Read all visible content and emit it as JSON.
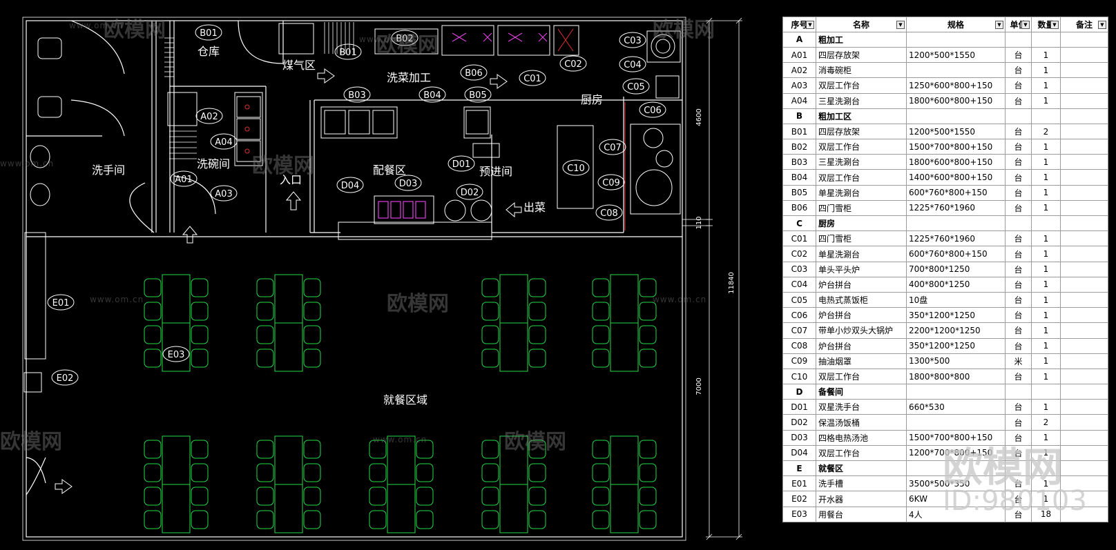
{
  "plan": {
    "labels": [
      {
        "text": "B01",
        "type": "tag"
      },
      {
        "text": "仓库",
        "type": "room"
      },
      {
        "text": "煤气区",
        "type": "room"
      },
      {
        "text": "B01",
        "type": "tag"
      },
      {
        "text": "B02",
        "type": "tag"
      },
      {
        "text": "洗菜加工",
        "type": "room"
      },
      {
        "text": "B06",
        "type": "tag"
      },
      {
        "text": "C01",
        "type": "tag"
      },
      {
        "text": "C02",
        "type": "tag"
      },
      {
        "text": "C03",
        "type": "tag"
      },
      {
        "text": "C04",
        "type": "tag"
      },
      {
        "text": "C05",
        "type": "tag"
      },
      {
        "text": "C06",
        "type": "tag"
      },
      {
        "text": "C07",
        "type": "tag"
      },
      {
        "text": "C09",
        "type": "tag"
      },
      {
        "text": "C08",
        "type": "tag"
      },
      {
        "text": "C10",
        "type": "tag"
      },
      {
        "text": "厨房",
        "type": "room"
      },
      {
        "text": "A02",
        "type": "tag"
      },
      {
        "text": "A04",
        "type": "tag"
      },
      {
        "text": "A01",
        "type": "tag"
      },
      {
        "text": "A03",
        "type": "tag"
      },
      {
        "text": "洗碗间",
        "type": "room"
      },
      {
        "text": "洗手间",
        "type": "room"
      },
      {
        "text": "入口",
        "type": "room"
      },
      {
        "text": "B03",
        "type": "tag"
      },
      {
        "text": "B04",
        "type": "tag"
      },
      {
        "text": "B05",
        "type": "tag"
      },
      {
        "text": "D01",
        "type": "tag"
      },
      {
        "text": "预进间",
        "type": "room"
      },
      {
        "text": "配餐区",
        "type": "room"
      },
      {
        "text": "D04",
        "type": "tag"
      },
      {
        "text": "D03",
        "type": "tag"
      },
      {
        "text": "D02",
        "type": "tag"
      },
      {
        "text": "出菜",
        "type": "room"
      },
      {
        "text": "E01",
        "type": "tag"
      },
      {
        "text": "E03",
        "type": "tag"
      },
      {
        "text": "E02",
        "type": "tag"
      },
      {
        "text": "就餐区域",
        "type": "room"
      }
    ],
    "dimensions": [
      "4600",
      "110",
      "11840",
      "7000"
    ]
  },
  "watermarks": {
    "brand": "欧模网",
    "site": "www.om.cn",
    "id": "ID:980103"
  },
  "table": {
    "headers": [
      "序号",
      "名称",
      "规格",
      "单位",
      "数量",
      "备注"
    ],
    "rows": [
      {
        "section": true,
        "code": "A",
        "name": "粗加工",
        "spec": "",
        "unit": "",
        "qty": ""
      },
      {
        "code": "A01",
        "name": "四层存放架",
        "spec": "1200*500*1550",
        "unit": "台",
        "qty": "1"
      },
      {
        "code": "A02",
        "name": "消毒碗柜",
        "spec": "",
        "unit": "台",
        "qty": "1"
      },
      {
        "code": "A03",
        "name": "双层工作台",
        "spec": "1250*600*800+150",
        "unit": "台",
        "qty": "1"
      },
      {
        "code": "A04",
        "name": "三星洗涮台",
        "spec": "1800*600*800+150",
        "unit": "台",
        "qty": "1"
      },
      {
        "section": true,
        "code": "B",
        "name": "粗加工区",
        "spec": "",
        "unit": "",
        "qty": ""
      },
      {
        "code": "B01",
        "name": "四层存放架",
        "spec": "1200*500*1550",
        "unit": "台",
        "qty": "2"
      },
      {
        "code": "B02",
        "name": "双层工作台",
        "spec": "1500*700*800+150",
        "unit": "台",
        "qty": "1"
      },
      {
        "code": "B03",
        "name": "三星洗涮台",
        "spec": "1800*600*800+150",
        "unit": "台",
        "qty": "1"
      },
      {
        "code": "B04",
        "name": "双层工作台",
        "spec": "1400*600*800+150",
        "unit": "台",
        "qty": "1"
      },
      {
        "code": "B05",
        "name": "单星洗涮台",
        "spec": "600*760*800+150",
        "unit": "台",
        "qty": "1"
      },
      {
        "code": "B06",
        "name": "四门雪柜",
        "spec": "1225*760*1960",
        "unit": "台",
        "qty": "1"
      },
      {
        "section": true,
        "code": "C",
        "name": "厨房",
        "spec": "",
        "unit": "",
        "qty": ""
      },
      {
        "code": "C01",
        "name": "四门雪柜",
        "spec": "1225*760*1960",
        "unit": "台",
        "qty": "1"
      },
      {
        "code": "C02",
        "name": "单星洗涮台",
        "spec": "600*760*800+150",
        "unit": "台",
        "qty": "1"
      },
      {
        "code": "C03",
        "name": "单头平头炉",
        "spec": "700*800*1250",
        "unit": "台",
        "qty": "1"
      },
      {
        "code": "C04",
        "name": "炉台拼台",
        "spec": "400*800*1250",
        "unit": "台",
        "qty": "1"
      },
      {
        "code": "C05",
        "name": "电热式蒸饭柜",
        "spec": "10盘",
        "unit": "台",
        "qty": "1"
      },
      {
        "code": "C06",
        "name": "炉台拼台",
        "spec": "350*1200*1250",
        "unit": "台",
        "qty": "1"
      },
      {
        "code": "C07",
        "name": "带单小炒双头大锅炉",
        "spec": "2200*1200*1250",
        "unit": "台",
        "qty": "1"
      },
      {
        "code": "C08",
        "name": "炉台拼台",
        "spec": "350*1200*1250",
        "unit": "台",
        "qty": "1"
      },
      {
        "code": "C09",
        "name": "抽油烟罩",
        "spec": "1300*500",
        "unit": "米",
        "qty": "1"
      },
      {
        "code": "C10",
        "name": "双层工作台",
        "spec": "1800*800*800",
        "unit": "台",
        "qty": "1"
      },
      {
        "section": true,
        "code": "D",
        "name": "备餐间",
        "spec": "",
        "unit": "",
        "qty": ""
      },
      {
        "code": "D01",
        "name": "双星洗手台",
        "spec": "660*530",
        "unit": "台",
        "qty": "1"
      },
      {
        "code": "D02",
        "name": "保温汤饭桶",
        "spec": "",
        "unit": "台",
        "qty": "2"
      },
      {
        "code": "D03",
        "name": "四格电热汤池",
        "spec": "1500*700*800+150",
        "unit": "台",
        "qty": "1"
      },
      {
        "code": "D04",
        "name": "双层工作台",
        "spec": "1200*700*800+150",
        "unit": "台",
        "qty": "1"
      },
      {
        "section": true,
        "code": "E",
        "name": "就餐区",
        "spec": "",
        "unit": "",
        "qty": ""
      },
      {
        "code": "E01",
        "name": "洗手槽",
        "spec": "3500*500*350",
        "unit": "台",
        "qty": "1"
      },
      {
        "code": "E02",
        "name": "开水器",
        "spec": "6KW",
        "unit": "台",
        "qty": "1"
      },
      {
        "code": "E03",
        "name": "用餐台",
        "spec": "4人",
        "unit": "台",
        "qty": "18"
      }
    ]
  }
}
